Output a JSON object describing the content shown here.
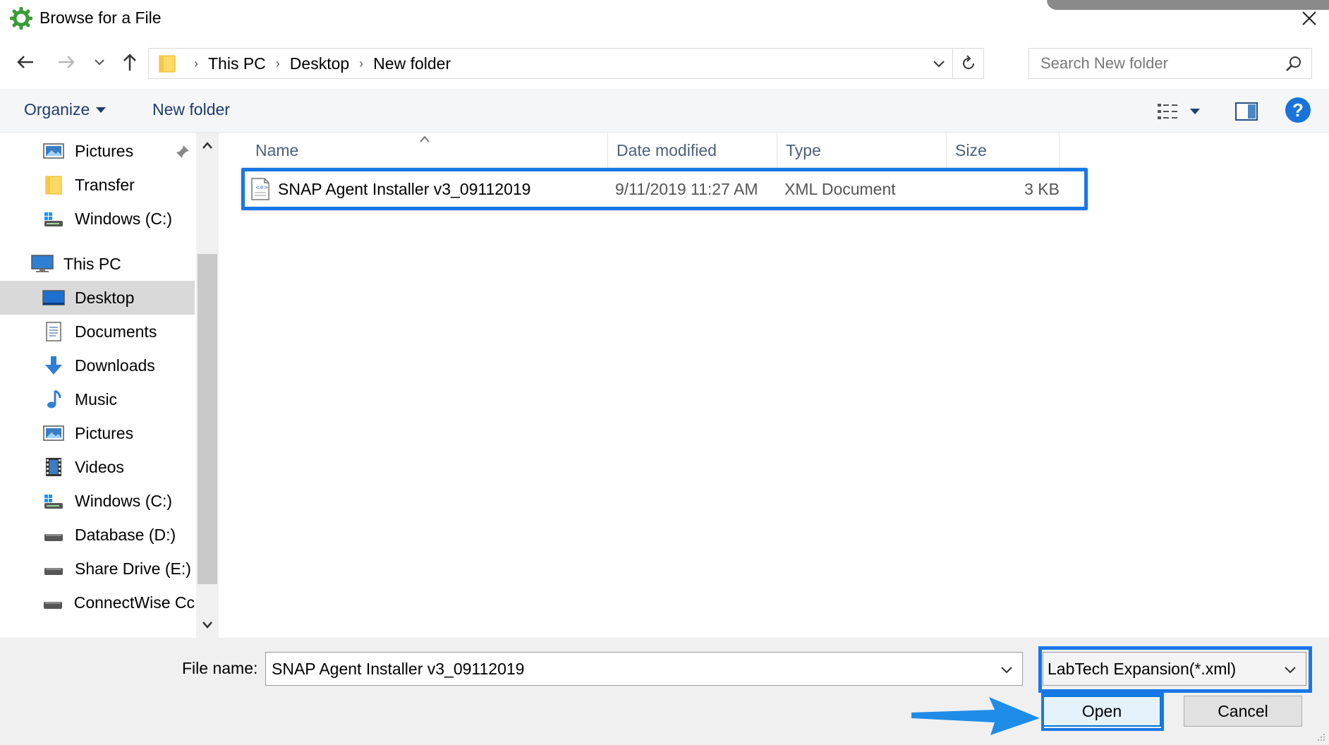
{
  "window": {
    "title": "Browse for a File"
  },
  "address": {
    "crumbs": [
      "This PC",
      "Desktop",
      "New folder"
    ]
  },
  "search": {
    "placeholder": "Search New folder"
  },
  "toolbar": {
    "organize_label": "Organize",
    "new_folder_label": "New folder"
  },
  "nav": {
    "items": [
      {
        "label": "Pictures",
        "icon": "pictures-icon",
        "pinned": true
      },
      {
        "label": "Transfer",
        "icon": "folder-icon"
      },
      {
        "label": "Windows (C:)",
        "icon": "drive-windows-icon"
      },
      {
        "label": "This PC",
        "icon": "computer-icon"
      },
      {
        "label": "Desktop",
        "icon": "desktop-icon",
        "selected": true
      },
      {
        "label": "Documents",
        "icon": "documents-icon"
      },
      {
        "label": "Downloads",
        "icon": "downloads-icon"
      },
      {
        "label": "Music",
        "icon": "music-icon"
      },
      {
        "label": "Pictures",
        "icon": "pictures-icon"
      },
      {
        "label": "Videos",
        "icon": "videos-icon"
      },
      {
        "label": "Windows (C:)",
        "icon": "drive-windows-icon"
      },
      {
        "label": "Database (D:)",
        "icon": "drive-icon"
      },
      {
        "label": "Share Drive (E:)",
        "icon": "drive-icon"
      },
      {
        "label": "ConnectWise Cc",
        "icon": "drive-icon"
      }
    ]
  },
  "columns": {
    "name": "Name",
    "date": "Date modified",
    "type": "Type",
    "size": "Size"
  },
  "files": [
    {
      "name": "SNAP Agent Installer v3_09112019",
      "date": "9/11/2019 11:27 AM",
      "type": "XML Document",
      "size": "3 KB"
    }
  ],
  "bottom": {
    "file_name_label": "File name:",
    "file_name_value": "SNAP Agent Installer v3_09112019",
    "filter_value": "LabTech Expansion(*.xml)",
    "open_label": "Open",
    "cancel_label": "Cancel"
  },
  "colors": {
    "accent": "#1877e6",
    "selected": "#d9d9d9",
    "link": "#1e3c6e"
  }
}
